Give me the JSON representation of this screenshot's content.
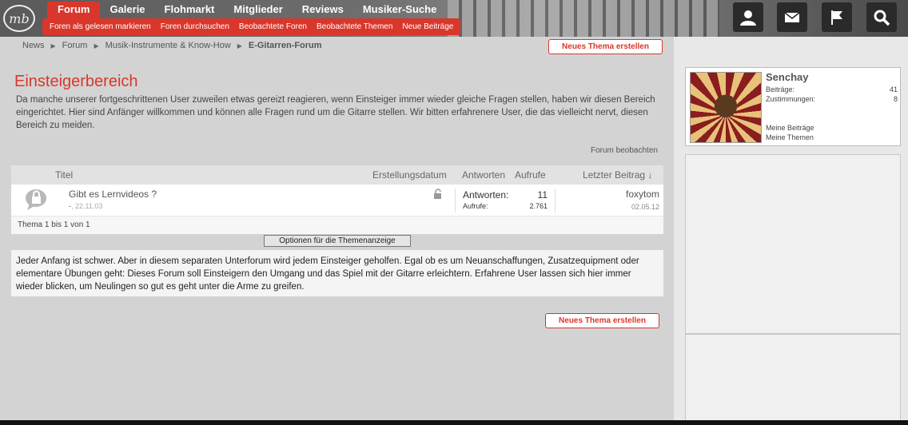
{
  "nav": {
    "logo_text": "mb",
    "items": [
      {
        "label": "Forum"
      },
      {
        "label": "Galerie"
      },
      {
        "label": "Flohmarkt"
      },
      {
        "label": "Mitglieder"
      },
      {
        "label": "Reviews"
      },
      {
        "label": "Musiker-Suche"
      }
    ],
    "subitems": [
      {
        "label": "Foren als gelesen markieren"
      },
      {
        "label": "Foren durchsuchen"
      },
      {
        "label": "Beobachtete Foren"
      },
      {
        "label": "Beobachtete Themen"
      },
      {
        "label": "Neue Beiträge"
      }
    ],
    "icons": [
      "user-icon",
      "mail-icon",
      "flag-icon",
      "search-icon"
    ]
  },
  "breadcrumb": [
    "News",
    "Forum",
    "Musik-Instrumente & Know-How",
    "E-Gitarren-Forum"
  ],
  "new_thread_label": "Neues Thema erstellen",
  "title": "Einsteigerbereich",
  "description": "Da manche unserer fortgeschrittenen User zuweilen etwas gereizt reagieren, wenn Einsteiger immer wieder gleiche Fragen stellen, haben wir diesen Bereich eingerichtet. Hier sind Anfänger willkommen und können alle Fragen rund um die Gitarre stellen. Wir bitten erfahrenere User, die das vielleicht nervt, diesen Bereich zu meiden.",
  "watch_label": "Forum beobachten",
  "table": {
    "headers": {
      "title": "Titel",
      "date": "Erstellungsdatum",
      "replies": "Antworten",
      "views": "Aufrufe",
      "last": "Letzter Beitrag ↓"
    },
    "rows": [
      {
        "title": "Gibt es Lernvideos ?",
        "author": "-",
        "date": "22.11.03",
        "replies_label": "Antworten:",
        "replies": "11",
        "views_label": "Aufrufe:",
        "views": "2.761",
        "last_user": "foxytom",
        "last_date": "02.05.12"
      }
    ],
    "footer": "Thema 1 bis 1 von 1"
  },
  "options_label": "Optionen für die Themenanzeige",
  "info_text": "Jeder Anfang ist schwer. Aber in diesem separaten Unterforum wird jedem Einsteiger geholfen. Egal ob es um Neuanschaffungen, Zusatzequipment oder elementare Übungen geht: Dieses Forum soll Einsteigern den Umgang und das Spiel mit der Gitarre erleichtern. Erfahrene User lassen sich hier immer wieder blicken, um Neulingen so gut es geht unter die Arme zu greifen.",
  "user": {
    "name": "Senchay",
    "posts_label": "Beiträge:",
    "posts": "41",
    "likes_label": "Zustimmungen:",
    "likes": "8",
    "my_posts": "Meine Beiträge",
    "my_threads": "Meine Themen"
  },
  "colors": {
    "accent": "#d9372b"
  }
}
